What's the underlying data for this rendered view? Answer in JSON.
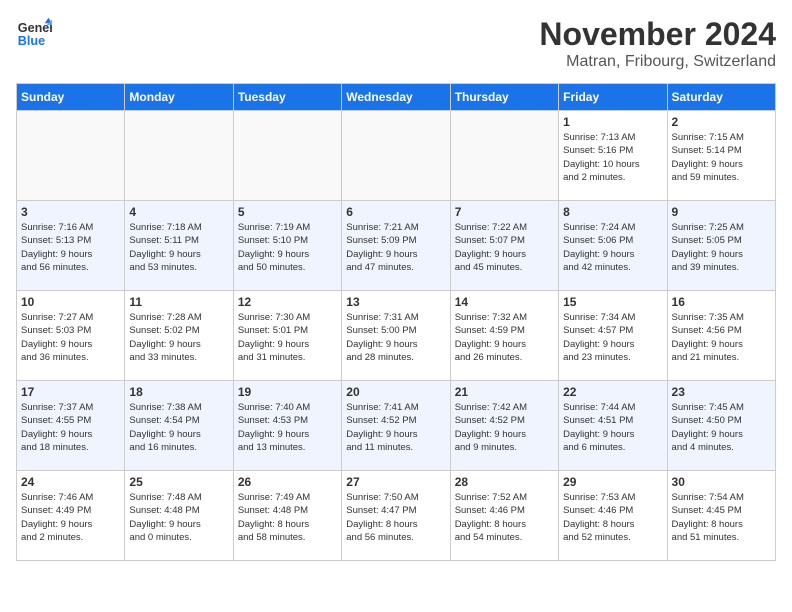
{
  "logo": {
    "line1": "General",
    "line2": "Blue"
  },
  "title": "November 2024",
  "location": "Matran, Fribourg, Switzerland",
  "days_of_week": [
    "Sunday",
    "Monday",
    "Tuesday",
    "Wednesday",
    "Thursday",
    "Friday",
    "Saturday"
  ],
  "weeks": [
    {
      "rowClass": "week-row-odd",
      "days": [
        {
          "num": "",
          "info": "",
          "empty": true
        },
        {
          "num": "",
          "info": "",
          "empty": true
        },
        {
          "num": "",
          "info": "",
          "empty": true
        },
        {
          "num": "",
          "info": "",
          "empty": true
        },
        {
          "num": "",
          "info": "",
          "empty": true
        },
        {
          "num": "1",
          "info": "Sunrise: 7:13 AM\nSunset: 5:16 PM\nDaylight: 10 hours\nand 2 minutes.",
          "empty": false
        },
        {
          "num": "2",
          "info": "Sunrise: 7:15 AM\nSunset: 5:14 PM\nDaylight: 9 hours\nand 59 minutes.",
          "empty": false
        }
      ]
    },
    {
      "rowClass": "week-row-even",
      "days": [
        {
          "num": "3",
          "info": "Sunrise: 7:16 AM\nSunset: 5:13 PM\nDaylight: 9 hours\nand 56 minutes.",
          "empty": false
        },
        {
          "num": "4",
          "info": "Sunrise: 7:18 AM\nSunset: 5:11 PM\nDaylight: 9 hours\nand 53 minutes.",
          "empty": false
        },
        {
          "num": "5",
          "info": "Sunrise: 7:19 AM\nSunset: 5:10 PM\nDaylight: 9 hours\nand 50 minutes.",
          "empty": false
        },
        {
          "num": "6",
          "info": "Sunrise: 7:21 AM\nSunset: 5:09 PM\nDaylight: 9 hours\nand 47 minutes.",
          "empty": false
        },
        {
          "num": "7",
          "info": "Sunrise: 7:22 AM\nSunset: 5:07 PM\nDaylight: 9 hours\nand 45 minutes.",
          "empty": false
        },
        {
          "num": "8",
          "info": "Sunrise: 7:24 AM\nSunset: 5:06 PM\nDaylight: 9 hours\nand 42 minutes.",
          "empty": false
        },
        {
          "num": "9",
          "info": "Sunrise: 7:25 AM\nSunset: 5:05 PM\nDaylight: 9 hours\nand 39 minutes.",
          "empty": false
        }
      ]
    },
    {
      "rowClass": "week-row-odd",
      "days": [
        {
          "num": "10",
          "info": "Sunrise: 7:27 AM\nSunset: 5:03 PM\nDaylight: 9 hours\nand 36 minutes.",
          "empty": false
        },
        {
          "num": "11",
          "info": "Sunrise: 7:28 AM\nSunset: 5:02 PM\nDaylight: 9 hours\nand 33 minutes.",
          "empty": false
        },
        {
          "num": "12",
          "info": "Sunrise: 7:30 AM\nSunset: 5:01 PM\nDaylight: 9 hours\nand 31 minutes.",
          "empty": false
        },
        {
          "num": "13",
          "info": "Sunrise: 7:31 AM\nSunset: 5:00 PM\nDaylight: 9 hours\nand 28 minutes.",
          "empty": false
        },
        {
          "num": "14",
          "info": "Sunrise: 7:32 AM\nSunset: 4:59 PM\nDaylight: 9 hours\nand 26 minutes.",
          "empty": false
        },
        {
          "num": "15",
          "info": "Sunrise: 7:34 AM\nSunset: 4:57 PM\nDaylight: 9 hours\nand 23 minutes.",
          "empty": false
        },
        {
          "num": "16",
          "info": "Sunrise: 7:35 AM\nSunset: 4:56 PM\nDaylight: 9 hours\nand 21 minutes.",
          "empty": false
        }
      ]
    },
    {
      "rowClass": "week-row-even",
      "days": [
        {
          "num": "17",
          "info": "Sunrise: 7:37 AM\nSunset: 4:55 PM\nDaylight: 9 hours\nand 18 minutes.",
          "empty": false
        },
        {
          "num": "18",
          "info": "Sunrise: 7:38 AM\nSunset: 4:54 PM\nDaylight: 9 hours\nand 16 minutes.",
          "empty": false
        },
        {
          "num": "19",
          "info": "Sunrise: 7:40 AM\nSunset: 4:53 PM\nDaylight: 9 hours\nand 13 minutes.",
          "empty": false
        },
        {
          "num": "20",
          "info": "Sunrise: 7:41 AM\nSunset: 4:52 PM\nDaylight: 9 hours\nand 11 minutes.",
          "empty": false
        },
        {
          "num": "21",
          "info": "Sunrise: 7:42 AM\nSunset: 4:52 PM\nDaylight: 9 hours\nand 9 minutes.",
          "empty": false
        },
        {
          "num": "22",
          "info": "Sunrise: 7:44 AM\nSunset: 4:51 PM\nDaylight: 9 hours\nand 6 minutes.",
          "empty": false
        },
        {
          "num": "23",
          "info": "Sunrise: 7:45 AM\nSunset: 4:50 PM\nDaylight: 9 hours\nand 4 minutes.",
          "empty": false
        }
      ]
    },
    {
      "rowClass": "week-row-odd",
      "days": [
        {
          "num": "24",
          "info": "Sunrise: 7:46 AM\nSunset: 4:49 PM\nDaylight: 9 hours\nand 2 minutes.",
          "empty": false
        },
        {
          "num": "25",
          "info": "Sunrise: 7:48 AM\nSunset: 4:48 PM\nDaylight: 9 hours\nand 0 minutes.",
          "empty": false
        },
        {
          "num": "26",
          "info": "Sunrise: 7:49 AM\nSunset: 4:48 PM\nDaylight: 8 hours\nand 58 minutes.",
          "empty": false
        },
        {
          "num": "27",
          "info": "Sunrise: 7:50 AM\nSunset: 4:47 PM\nDaylight: 8 hours\nand 56 minutes.",
          "empty": false
        },
        {
          "num": "28",
          "info": "Sunrise: 7:52 AM\nSunset: 4:46 PM\nDaylight: 8 hours\nand 54 minutes.",
          "empty": false
        },
        {
          "num": "29",
          "info": "Sunrise: 7:53 AM\nSunset: 4:46 PM\nDaylight: 8 hours\nand 52 minutes.",
          "empty": false
        },
        {
          "num": "30",
          "info": "Sunrise: 7:54 AM\nSunset: 4:45 PM\nDaylight: 8 hours\nand 51 minutes.",
          "empty": false
        }
      ]
    }
  ]
}
